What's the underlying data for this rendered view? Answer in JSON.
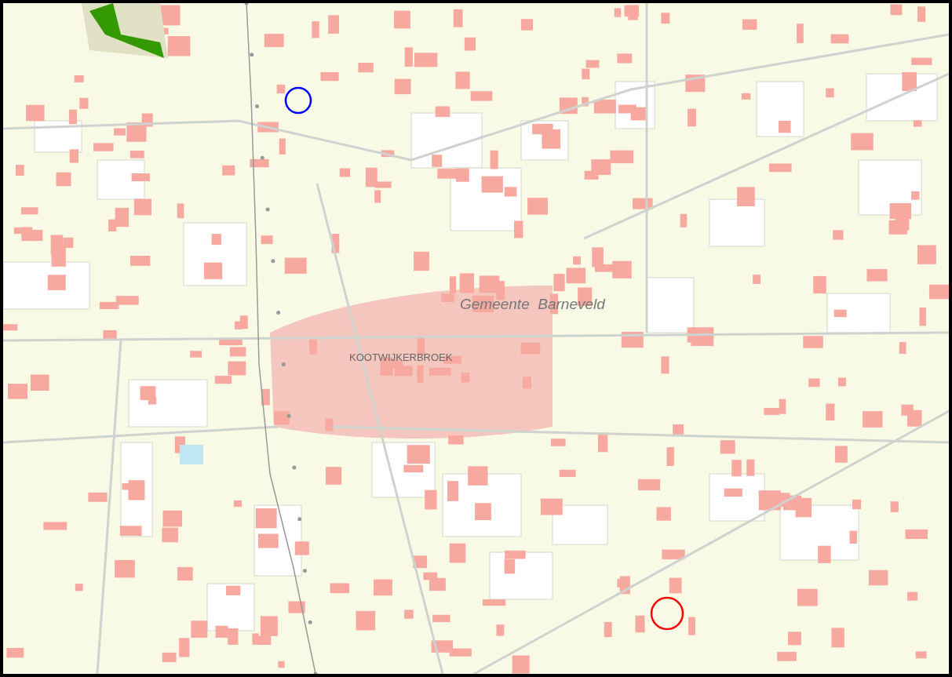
{
  "map": {
    "labels": [
      {
        "text": "Gemeente  Barneveld",
        "kind": "municipality"
      },
      {
        "text": "KOOTWIJKERBROEK",
        "kind": "place"
      }
    ],
    "markers": [
      {
        "color": "#0000ff"
      },
      {
        "color": "#ff0000"
      }
    ]
  }
}
